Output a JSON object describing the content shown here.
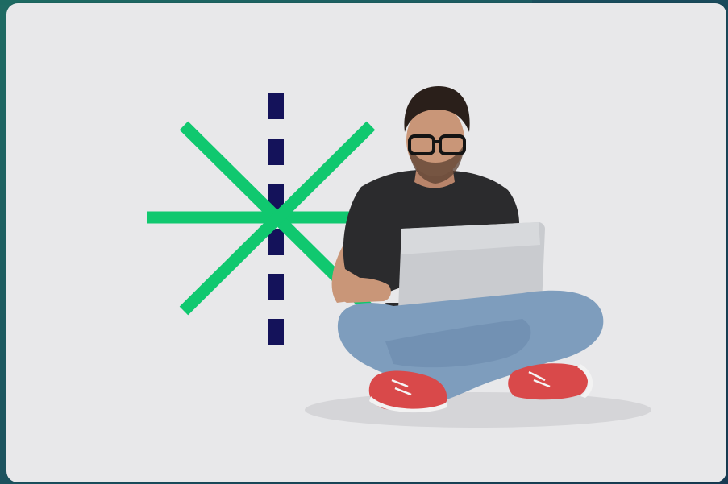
{
  "photo": {
    "subject": "man-with-laptop",
    "colors": {
      "background": "#e8e8ea",
      "accent_green": "#10c86f",
      "accent_navy": "#14125a",
      "shirt": "#2b2b2d",
      "jeans": "#7e9dbd",
      "laptop": "#c9cbcf",
      "sneakers": "#d9494a",
      "skin": "#c99678",
      "hair": "#2a1f1a"
    }
  }
}
